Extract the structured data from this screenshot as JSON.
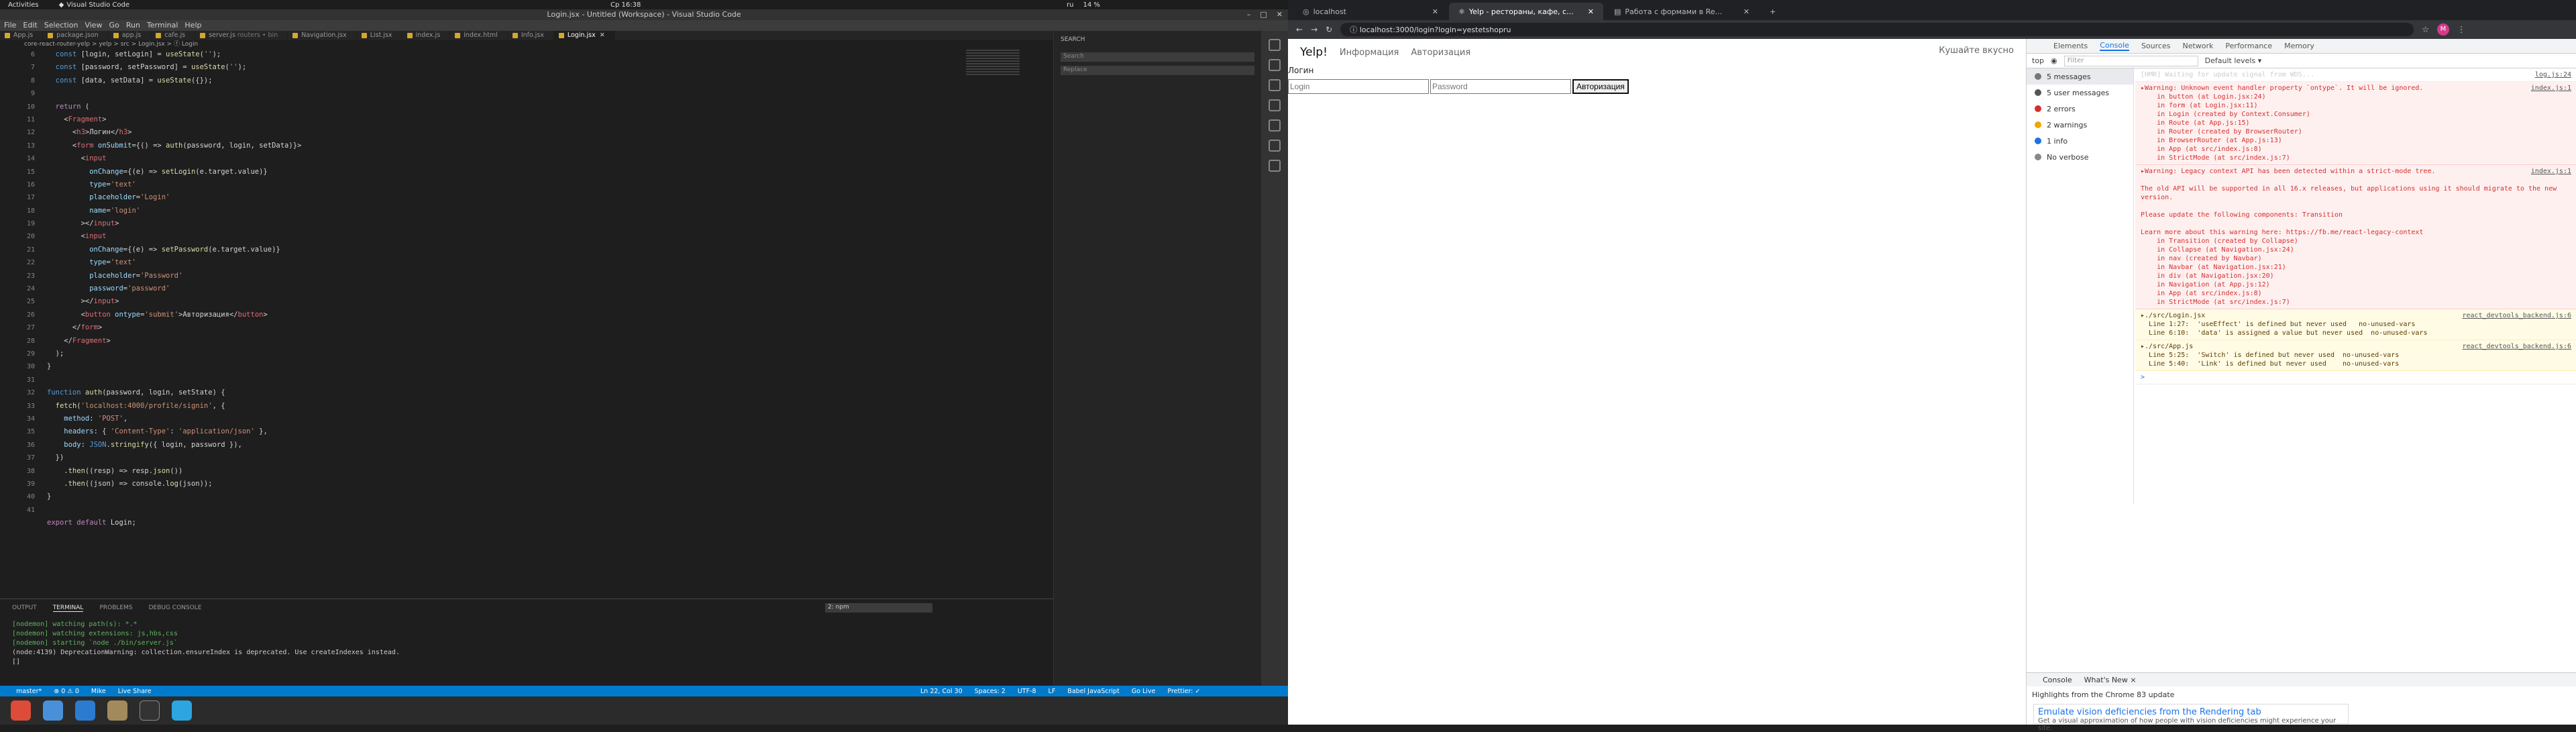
{
  "topbar": {
    "activities": "Activities",
    "app": "Visual Studio Code",
    "clock": "Ср 16:38",
    "lang": "ru",
    "battery": "14 %"
  },
  "vscode": {
    "title": "Login.jsx - Untitled (Workspace) - Visual Studio Code",
    "menu": [
      "File",
      "Edit",
      "Selection",
      "View",
      "Go",
      "Run",
      "Terminal",
      "Help"
    ],
    "tabs": [
      {
        "label": "App.js"
      },
      {
        "label": "package.json"
      },
      {
        "label": "app.js"
      },
      {
        "label": "cafe.js"
      },
      {
        "label": "server.js",
        "hint": "routers • bin"
      },
      {
        "label": "Navigation.jsx"
      },
      {
        "label": "List.jsx"
      },
      {
        "label": "index.js"
      },
      {
        "label": "index.html"
      },
      {
        "label": "Info.jsx"
      },
      {
        "label": "Login.jsx",
        "active": true
      }
    ],
    "breadcrumbs": "core-react-router-yelp > yelp > src > Login.jsx > ⓕ Login",
    "search": {
      "title": "SEARCH",
      "placeholder": "Search",
      "replace": "Replace",
      "replace_btn": "AB"
    },
    "lines": [
      "6",
      "7",
      "8",
      "9",
      "10",
      "11",
      "12",
      "13",
      "14",
      "15",
      "16",
      "17",
      "18",
      "19",
      "20",
      "21",
      "22",
      "23",
      "24",
      "25",
      "26",
      "27",
      "28",
      "29",
      "30",
      "31",
      "32",
      "33",
      "34",
      "35",
      "36",
      "37",
      "38",
      "39",
      "40",
      "41"
    ],
    "panel": {
      "tabs": [
        "OUTPUT",
        "TERMINAL",
        "PROBLEMS",
        "DEBUG CONSOLE"
      ],
      "select": "2: npm",
      "terminal": [
        "[nodemon] watching path(s): *.*",
        "[nodemon] watching extensions: js,hbs,css",
        "[nodemon] starting `node ./bin/server.js`",
        "(node:4139) DeprecationWarning: collection.ensureIndex is deprecated. Use createIndexes instead.",
        "[]"
      ]
    },
    "status": {
      "branch": "master*",
      "errors": "⊗ 0 ⚠ 0",
      "user": "Mike",
      "share": "Live Share",
      "pos": "Ln 22, Col 30",
      "spaces": "Spaces: 2",
      "enc": "UTF-8",
      "eol": "LF",
      "lang": "Babel JavaScript",
      "live": "Go Live",
      "prettier": "Prettier: ✓"
    }
  },
  "chrome": {
    "tabs": [
      {
        "label": "localhost"
      },
      {
        "label": "Yelp - рестораны, кафе, с...",
        "active": true
      },
      {
        "label": "Работа с формами в Re..."
      }
    ],
    "url": "localhost:3000/login?login=yestetshopru",
    "avatar": "M",
    "page": {
      "brand": "Yelp!",
      "nav": [
        "Информация",
        "Авторизация"
      ],
      "right": "Кушайте вкусно",
      "heading": "Логин",
      "login_ph": "Login",
      "password_ph": "Password",
      "button": "Авторизация"
    },
    "devtools": {
      "tabs": [
        "Elements",
        "Console",
        "Sources",
        "Network",
        "Performance",
        "Memory"
      ],
      "context": "top",
      "filter": "Filter",
      "levels": "Default levels ▾",
      "side": [
        "5 messages",
        "5 user messages",
        "2 errors",
        "2 warnings",
        "1 info",
        "No verbose"
      ],
      "logs": [
        {
          "type": "info",
          "text": "[HMR] Waiting for update signal from WDS...",
          "src": "log.js:24"
        },
        {
          "type": "err",
          "text": "▸Warning: Unknown event handler property `ontype`. It will be ignored.\n    in button (at Login.jsx:24)\n    in form (at Login.jsx:11)\n    in Login (created by Context.Consumer)\n    in Route (at App.js:15)\n    in Router (created by BrowserRouter)\n    in BrowserRouter (at App.js:13)\n    in App (at src/index.js:8)\n    in StrictMode (at src/index.js:7)",
          "src": "index.js:1"
        },
        {
          "type": "err",
          "text": "▸Warning: Legacy context API has been detected within a strict-mode tree.\n\nThe old API will be supported in all 16.x releases, but applications using it should migrate to the new version.\n\nPlease update the following components: Transition\n\nLearn more about this warning here: https://fb.me/react-legacy-context\n    in Transition (created by Collapse)\n    in Collapse (at Navigation.jsx:24)\n    in nav (created by Navbar)\n    in Navbar (at Navigation.jsx:21)\n    in div (at Navigation.jsx:20)\n    in Navigation (at App.js:12)\n    in App (at src/index.js:8)\n    in StrictMode (at src/index.js:7)",
          "src": "index.js:1"
        },
        {
          "type": "warn",
          "text": "▸./src/Login.jsx\n  Line 1:27:  'useEffect' is defined but never used   no-unused-vars\n  Line 6:10:  'data' is assigned a value but never used  no-unused-vars",
          "src": "react_devtools_backend.js:6"
        },
        {
          "type": "warn",
          "text": "▸./src/App.js\n  Line 5:25:  'Switch' is defined but never used  no-unused-vars\n  Line 5:40:  'Link' is defined but never used    no-unused-vars",
          "src": "react_devtools_backend.js:6"
        }
      ],
      "prompt": ">",
      "drawer": {
        "tabs": [
          "Console",
          "What's New ×"
        ],
        "highlight": "Highlights from the Chrome 83 update",
        "emu_title": "Emulate vision deficiencies from the Rendering tab",
        "emu_text": "Get a visual approximation of how people with vision deficiencies might experience your site."
      }
    }
  }
}
